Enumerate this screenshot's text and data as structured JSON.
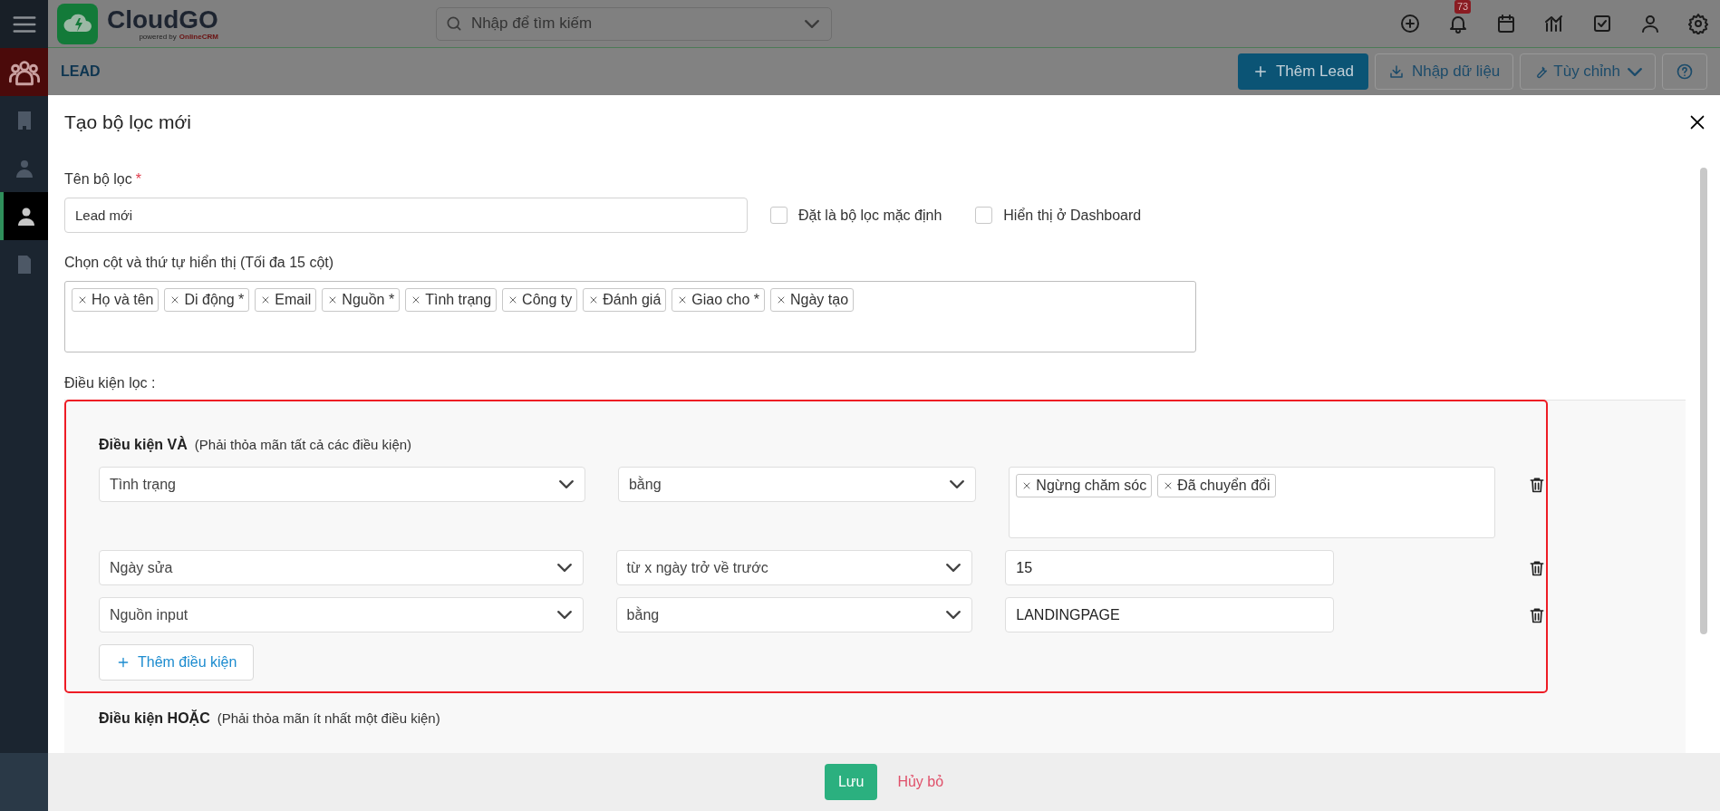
{
  "topbar": {
    "logo_name": "CloudGO",
    "logo_tagline": "powered by",
    "logo_brand": "OnlineCRM",
    "search": {
      "placeholder": "Nhập để tìm kiếm"
    },
    "notification_count": "73"
  },
  "sidebar": {
    "items": [
      {
        "kind": "module",
        "selected": false
      },
      {
        "kind": "building",
        "selected": false
      },
      {
        "kind": "contact",
        "selected": false
      },
      {
        "kind": "person",
        "selected": true
      },
      {
        "kind": "card",
        "selected": false
      }
    ]
  },
  "page": {
    "title": "LEAD",
    "buttons": [
      {
        "kind": "primary",
        "label": "Thêm Lead"
      },
      {
        "kind": "import",
        "label": "Nhập dữ liệu"
      },
      {
        "kind": "dropdown",
        "label": "Tùy chỉnh"
      },
      {
        "kind": "help"
      }
    ]
  },
  "dialog": {
    "title": "Tạo bộ lọc mới",
    "name_field": {
      "label": "Tên bộ lọc",
      "required_mark": "*",
      "value": "Lead mới"
    },
    "options": [
      {
        "label": "Đặt là bộ lọc mặc định",
        "checked": false
      },
      {
        "label": "Hiển thị ở Dashboard",
        "checked": false
      }
    ],
    "columns_label": "Chọn cột và thứ tự hiển thị (Tối đa 15 cột)",
    "columns": [
      "Họ và tên",
      "Di động *",
      "Email",
      "Nguồn *",
      "Tình trạng",
      "Công ty",
      "Đánh giá",
      "Giao cho *",
      "Ngày tạo"
    ],
    "conditions_label": "Điều kiện lọc :",
    "groups": [
      {
        "title": "Điều kiện VÀ",
        "note": "(Phải thỏa mãn tất cả các điều kiện)",
        "highlighted": true,
        "rows": [
          {
            "kind": "tags",
            "field": "Tình trạng",
            "operator": "bằng",
            "values": [
              "Ngừng chăm sóc",
              "Đã chuyển đổi"
            ]
          },
          {
            "kind": "short",
            "field": "Ngày sửa",
            "operator": "từ x ngày trở về trước",
            "value": "15"
          },
          {
            "kind": "short",
            "field": "Nguồn input",
            "operator": "bằng",
            "value": "LANDINGPAGE"
          }
        ],
        "add_button": "Thêm điều kiện"
      },
      {
        "title": "Điều kiện HOẶC",
        "note": "(Phải thỏa mãn ít nhất một điều kiện)",
        "highlighted": false
      }
    ]
  },
  "footer": {
    "save": "Lưu",
    "cancel": "Hủy bỏ"
  }
}
